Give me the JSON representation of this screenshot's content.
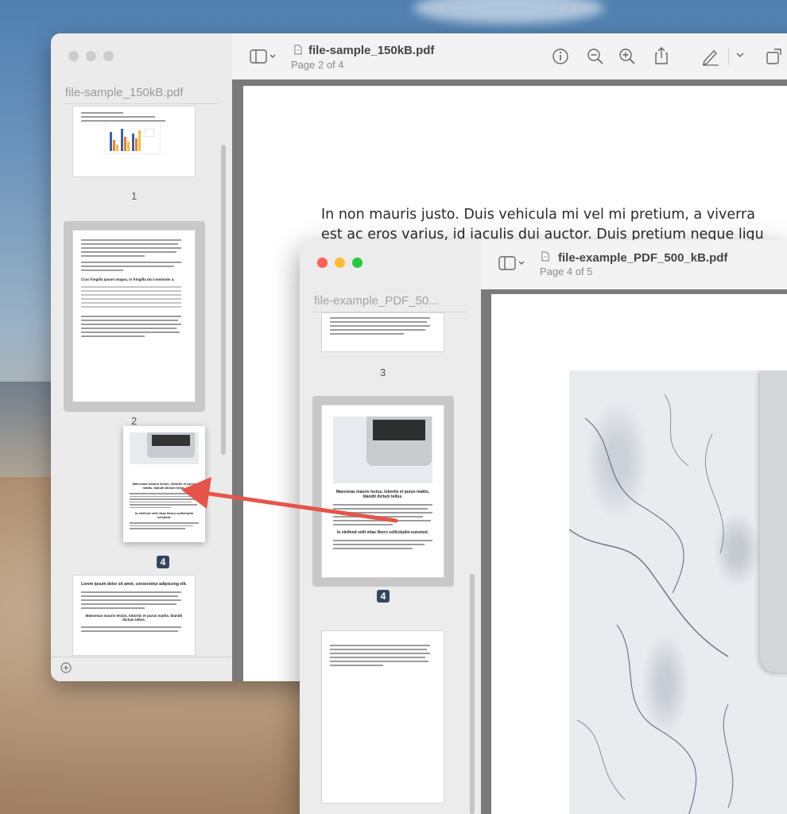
{
  "window_back": {
    "sidebar_title": "file-sample_150kB.pdf",
    "file_title": "file-sample_150kB.pdf",
    "page_info": "Page 2 of 4",
    "thumbnails": [
      {
        "number": "1"
      },
      {
        "number": "2",
        "heading": "Cras fringilla ipsum magna, in fringilla dui commodo a."
      },
      {
        "number": "4",
        "heading": "Lorem ipsum dolor sit amet, consectetur adipiscing elit.",
        "subheading": "Maecenas mauris lectus, lobortis et purus mattis, blandit dictum tellus."
      }
    ],
    "body_text": [
      "In non mauris justo. Duis vehicula mi vel mi pretium, a viverra",
      "est ac eros varius, id iaculis dui auctor. Duis pretium neque ligu"
    ],
    "toolbar_icons": [
      "sidebar-toggle-icon",
      "info-icon",
      "zoom-out-icon",
      "zoom-in-icon",
      "share-icon",
      "markup-pen-icon",
      "rotate-icon"
    ]
  },
  "dragged_thumbnail": {
    "number": "4",
    "heading": "Maecenas mauris lectus, lobortis et purus mattis, blandit dictum tellus.",
    "subheading": "In eleifend velit vitae libero sollicitudin euismod."
  },
  "window_front": {
    "sidebar_title": "file-example_PDF_50...",
    "file_title": "file-example_PDF_500_kB.pdf",
    "page_info": "Page 4 of 5",
    "thumbnails": [
      {
        "number": "3"
      },
      {
        "number": "4",
        "heading": "Maecenas mauris lectus, lobortis et purus mattis, blandit dictum tellus.",
        "subheading": "In eleifend velit vitae libero sollicitudin euismod."
      },
      {
        "number": ""
      }
    ]
  },
  "colors": {
    "close": "#ff5f57",
    "minimize": "#febc2e",
    "zoom": "#28c840",
    "arrow": "#e5554a",
    "badge": "#32465e"
  }
}
